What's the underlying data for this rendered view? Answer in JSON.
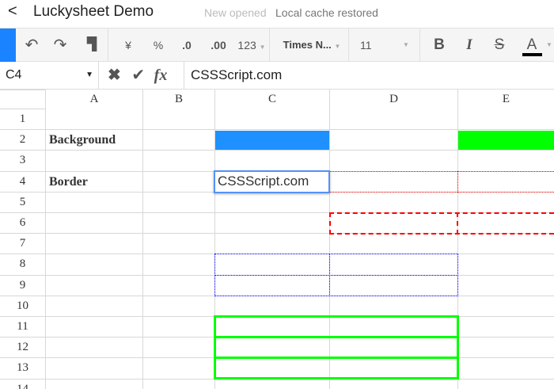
{
  "header": {
    "back": "<",
    "title": "Luckysheet Demo",
    "status_new": "New opened",
    "status_cache": "Local cache restored"
  },
  "toolbar": {
    "currency": "¥",
    "percent": "%",
    "dec_less": ".0",
    "dec_more": ".00",
    "format": "123",
    "font": "Times N...",
    "size": "11",
    "bold": "B",
    "italic": "I",
    "strike": "S",
    "color": "A",
    "text_color": "#000000"
  },
  "formula_bar": {
    "cell_ref": "C4",
    "value": "CSSScript.com"
  },
  "columns": [
    "A",
    "B",
    "C",
    "D",
    "E"
  ],
  "rows": [
    "1",
    "2",
    "3",
    "4",
    "5",
    "6",
    "7",
    "8",
    "9",
    "10",
    "11",
    "12",
    "13",
    "14"
  ],
  "cells": {
    "A2": "Background",
    "A4": "Border",
    "C4": "CSSScript.com"
  },
  "colors": {
    "blue_fill": "#1e90ff",
    "green_fill": "#00ff00",
    "selection": "#5292f7",
    "red_border": "#ff0000",
    "blue_border": "#0000ff",
    "green_border": "#00ff00"
  }
}
